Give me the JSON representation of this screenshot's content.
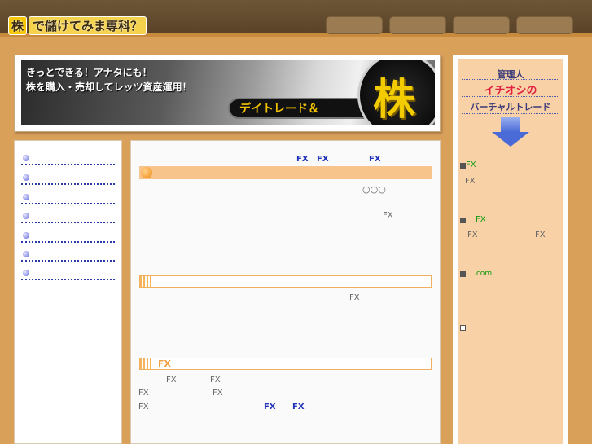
{
  "header": {
    "logo_kabu": "株",
    "logo_rest": "で儲けてみま専科？"
  },
  "banner": {
    "line1": "きっとできる！アナタにも！",
    "line2": "株を購入・売却してレッツ資産運用！",
    "pill_text": "デイトレード＆",
    "big_glyph": "株"
  },
  "main": {
    "row1": [
      "FX",
      "FX",
      "FX"
    ],
    "circles": "○○○",
    "fx_a": "FX",
    "fx_b": "FX",
    "section2_label": "FX",
    "row3a": [
      "FX",
      "FX"
    ],
    "row3b": [
      "FX",
      "FX"
    ],
    "row3c_gray": "FX",
    "row3c_blue": [
      "FX",
      "FX"
    ]
  },
  "sidebar": {
    "heading1": "管理人",
    "heading2": "イチオシの",
    "heading3": "バーチャルトレード",
    "item1_label": "FX",
    "item1_sub": "FX",
    "item2_label": "FX",
    "item2_sub_left": "FX",
    "item2_sub_right": "FX",
    "item3_label": ".com"
  },
  "colors": {
    "background": "#d9a05a",
    "header": "#5a4328",
    "accent_orange": "#f7c48c",
    "link_blue": "#2233bb"
  }
}
